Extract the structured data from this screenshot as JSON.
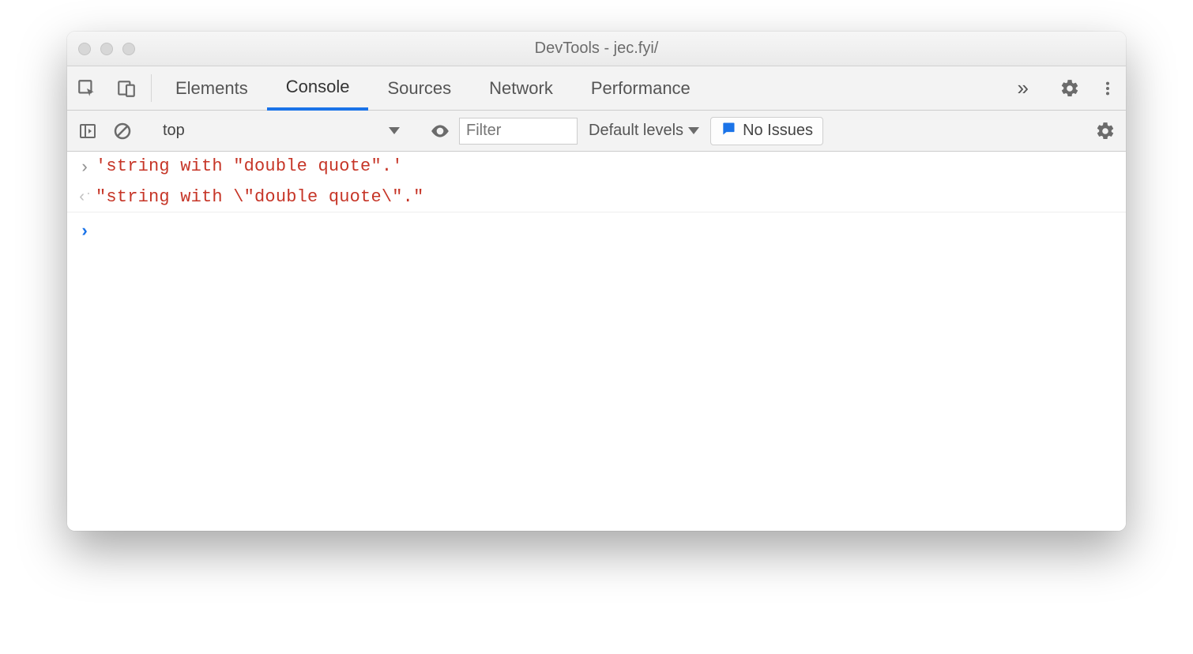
{
  "window": {
    "title": "DevTools - jec.fyi/"
  },
  "tabs": {
    "items": [
      "Elements",
      "Console",
      "Sources",
      "Network",
      "Performance"
    ],
    "active_index": 1
  },
  "console_toolbar": {
    "context": "top",
    "filter_placeholder": "Filter",
    "levels_label": "Default levels",
    "issues_label": "No Issues"
  },
  "console": {
    "lines": [
      {
        "kind": "input",
        "text": "'string with \"double quote\".'"
      },
      {
        "kind": "output",
        "text": "\"string with \\\"double quote\\\".\""
      }
    ]
  }
}
